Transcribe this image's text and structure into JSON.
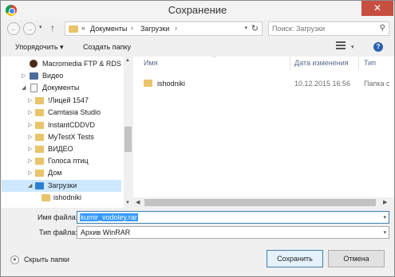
{
  "window": {
    "title": "Сохранение",
    "close_glyph": "✕"
  },
  "nav": {
    "back_glyph": "←",
    "forward_glyph": "→",
    "up_glyph": "↑",
    "address": {
      "prefix": "«",
      "crumbs": [
        "Документы",
        "Загрузки"
      ]
    },
    "search_placeholder": "Поиск: Загрузки"
  },
  "toolbar": {
    "organize_label": "Упорядочить ▾",
    "new_folder_label": "Создать папку"
  },
  "tree": [
    {
      "label": "Macromedia FTP & RDS",
      "icon": "flash-icon"
    },
    {
      "label": "Видео",
      "icon": "video-icon"
    },
    {
      "label": "Документы",
      "icon": "documents-icon"
    },
    {
      "label": "!Лицей 1547",
      "icon": "folder-icon"
    },
    {
      "label": "Camtasia Studio",
      "icon": "folder-icon"
    },
    {
      "label": "InstantCDDVD",
      "icon": "folder-icon"
    },
    {
      "label": "MyTestX Tests",
      "icon": "folder-icon"
    },
    {
      "label": "ВИДЕО",
      "icon": "folder-icon"
    },
    {
      "label": "Голоса птиц",
      "icon": "folder-icon"
    },
    {
      "label": "Дом",
      "icon": "folder-icon"
    },
    {
      "label": "Загрузки",
      "icon": "downloads-folder-icon"
    },
    {
      "label": "ishodniki",
      "icon": "folder-icon"
    }
  ],
  "columns": {
    "name": "Имя",
    "date": "Дата изменения",
    "type": "Тип"
  },
  "files": [
    {
      "name": "ishodniki",
      "date": "10.12.2015 16:56",
      "type": "Папка с"
    }
  ],
  "form": {
    "filename_label": "Имя файла:",
    "filename_value": "kumir_vodoley.rar",
    "filetype_label": "Тип файла:",
    "filetype_value": "Архив WinRAR"
  },
  "footer": {
    "hide_folders_label": "Скрыть папки",
    "save_label": "Сохранить",
    "cancel_label": "Отмена"
  },
  "colors": {
    "accent": "#3399ff",
    "close": "#c74f40",
    "selected_tree": "#cde8ff",
    "folder": "#e9c46a"
  }
}
